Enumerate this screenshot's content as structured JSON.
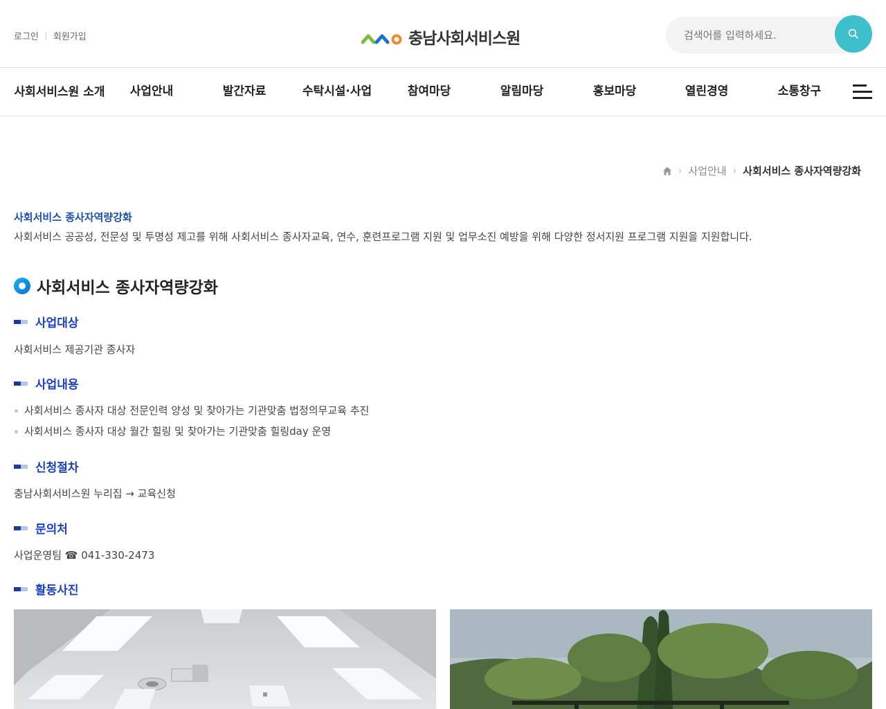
{
  "header": {
    "util": {
      "login": "로그인",
      "signup": "회원가입"
    },
    "logo_text": "충남사회서비스원",
    "search": {
      "placeholder": "검색어를 입력하세요."
    }
  },
  "gnb": {
    "items": [
      {
        "label": "사회서비스원 소개"
      },
      {
        "label": "사업안내"
      },
      {
        "label": "발간자료"
      },
      {
        "label": "수탁시설·사업"
      },
      {
        "label": "참여마당"
      },
      {
        "label": "알림마당"
      },
      {
        "label": "홍보마당"
      },
      {
        "label": "열린경영"
      },
      {
        "label": "소통창구"
      }
    ]
  },
  "breadcrumb": {
    "level1": "사업안내",
    "current": "사회서비스 종사자역량강화"
  },
  "intro": {
    "title": "사회서비스 종사자역량강화",
    "description": "사회서비스 공공성, 전문성 및 투명성 제고를 위해 사회서비스 종사자교육, 연수, 훈련프로그램 지원 및 업무소진 예방을 위해 다양한 정서지원 프로그램 지원을 지원합니다."
  },
  "main": {
    "title": "사회서비스 종사자역량강화",
    "sections": {
      "target": {
        "heading": "사업대상",
        "text": "사회서비스 제공기관 종사자"
      },
      "content": {
        "heading": "사업내용",
        "items": [
          "사회서비스 종사자 대상 전문인력 양성 및 찾아가는 기관맞춤 법정의무교육 추진",
          "사회서비스 종사자 대상 월간 힐링 및 찾아가는 기관맞춤 힐링day 운영"
        ]
      },
      "procedure": {
        "heading": "신청절차",
        "text": "충남사회서비스원 누리집 → 교육신청"
      },
      "contact": {
        "heading": "문의처",
        "text": "사업운영팀 ☎ 041-330-2473"
      },
      "photos": {
        "heading": "활동사진"
      }
    }
  },
  "colors": {
    "accent": "#3dbfcc",
    "heading_blue": "#1b3fc4",
    "intro_blue": "#1b4fb0"
  }
}
